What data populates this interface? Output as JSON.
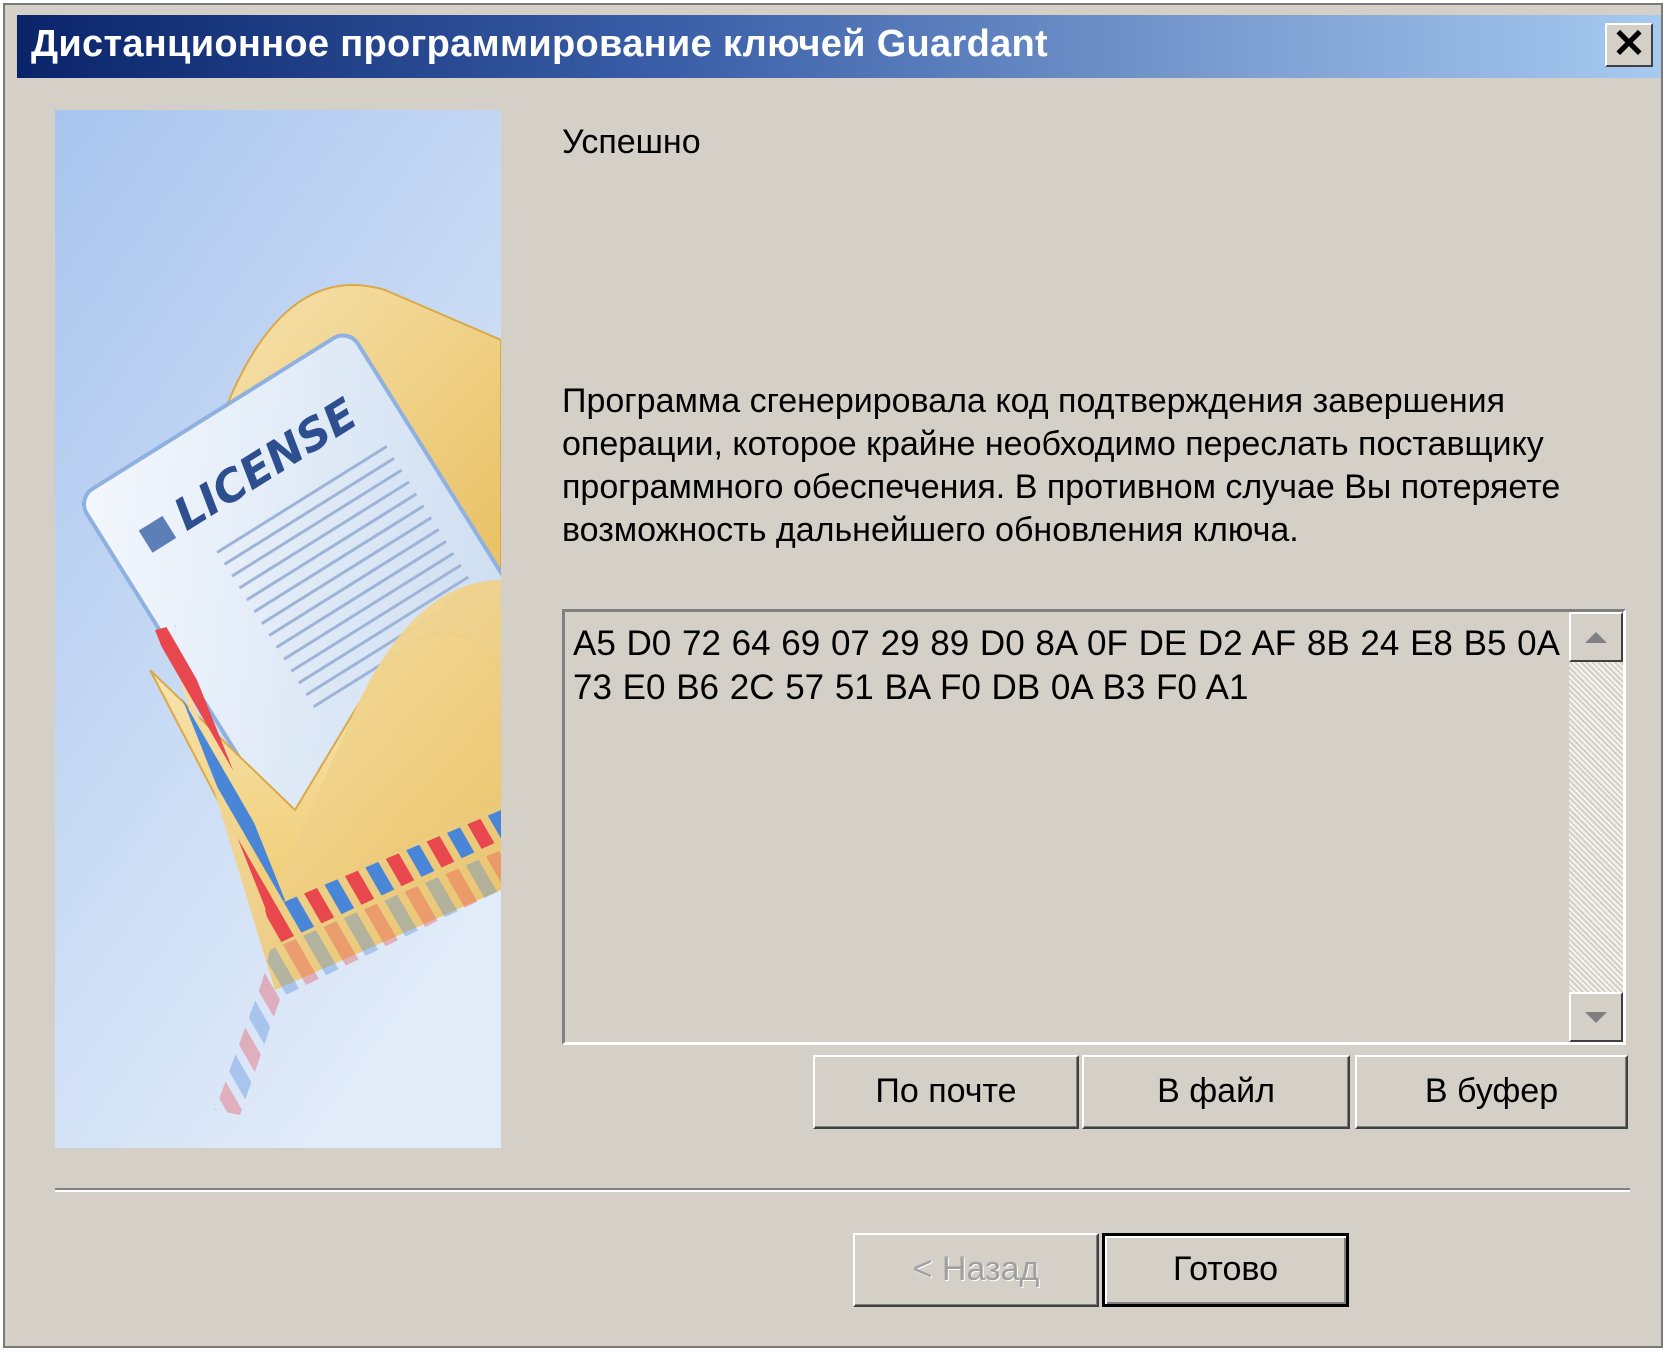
{
  "window": {
    "title": "Дистанционное программирование ключей Guardant",
    "close_glyph": "✕"
  },
  "illustration": {
    "label": "LICENSE",
    "icon": "license-envelope-illustration"
  },
  "status_heading": "Успешно",
  "message": "Программа сгенерировала код подтверждения завершения операции, которое крайне необходимо переслать поставщику программного обеспечения. В противном случае Вы потеряете возможность дальнейшего обновления ключа.",
  "confirmation_code": "A5 D0 72 64 69 07 29 89 D0 8A 0F DE D2 AF 8B 24 E8 B5 0A 73 E0 B6 2C 57 51 BA F0 DB 0A B3 F0 A1",
  "export_buttons": {
    "email": "По почте",
    "file": "В файл",
    "clipboard": "В буфер"
  },
  "nav_buttons": {
    "back": "< Назад",
    "finish": "Готово"
  },
  "colors": {
    "title_start": "#0a246a",
    "title_end": "#a6caf0",
    "face": "#d4d0c8"
  }
}
